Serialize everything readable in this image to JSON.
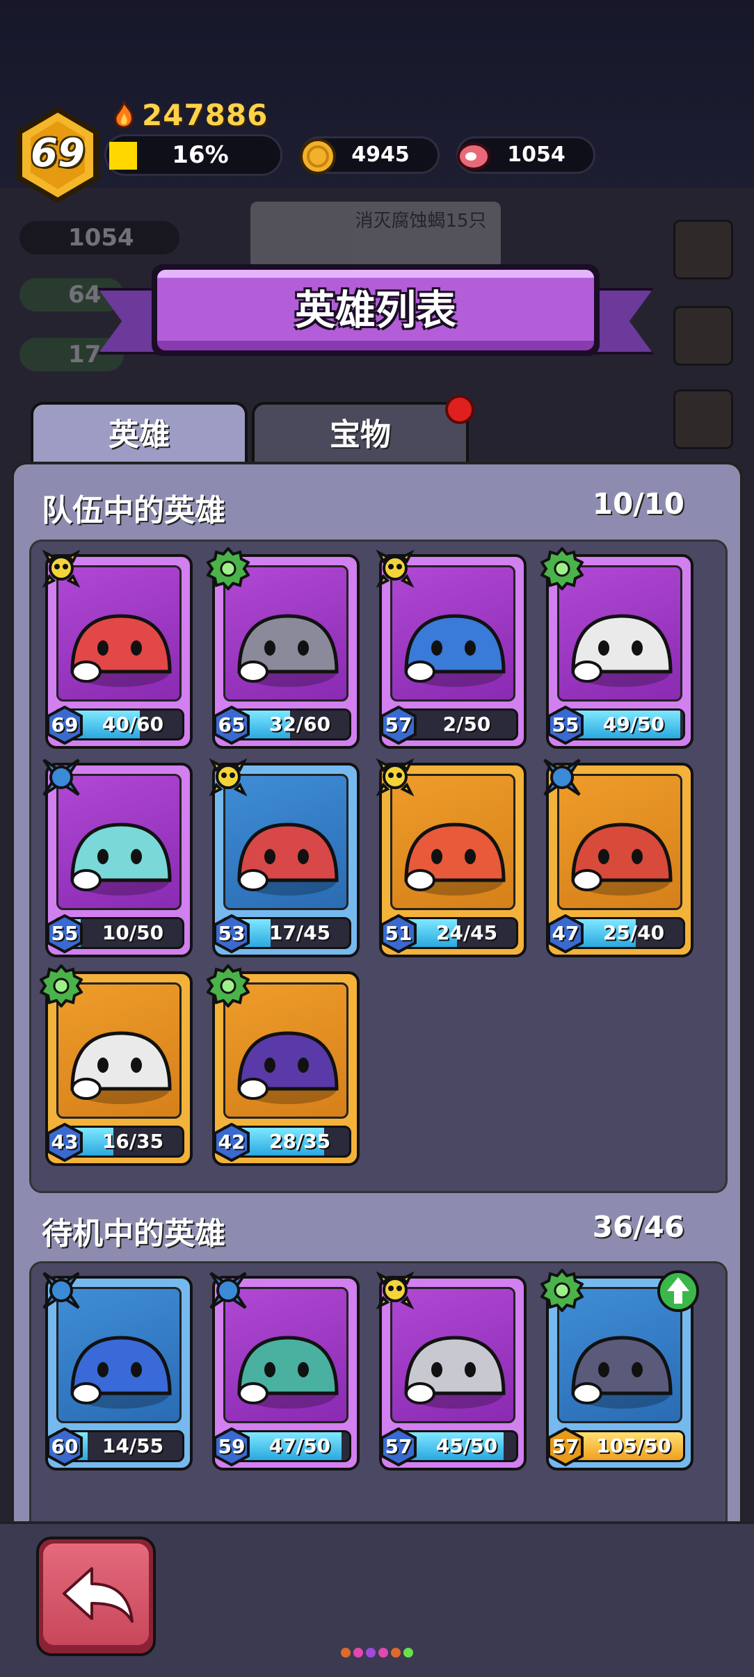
{
  "header": {
    "level": "69",
    "power": "247886",
    "xp_percent_text": "16%",
    "xp_fraction": 0.16,
    "gold": "4945",
    "meat": "1054"
  },
  "background": {
    "meat": "1054",
    "wood": "64",
    "ore": "17",
    "quest": "消灭腐蚀蝎15只"
  },
  "title": "英雄列表",
  "tabs": [
    {
      "label": "英雄",
      "active": true
    },
    {
      "label": "宝物",
      "active": false,
      "badge": true
    }
  ],
  "team": {
    "heading": "队伍中的英雄",
    "count": "10/10",
    "heroes": [
      {
        "level": "69",
        "progress": "40/60",
        "frame": "purple",
        "class": "yellow-skull",
        "fill": 0.667,
        "full": false
      },
      {
        "level": "65",
        "progress": "32/60",
        "frame": "purple",
        "class": "green-gear",
        "fill": 0.533,
        "full": false
      },
      {
        "level": "57",
        "progress": "2/50",
        "frame": "purple",
        "class": "yellow-skull",
        "fill": 0.04,
        "full": false
      },
      {
        "level": "55",
        "progress": "49/50",
        "frame": "purple",
        "class": "green-gear",
        "fill": 0.98,
        "full": false
      },
      {
        "level": "55",
        "progress": "10/50",
        "frame": "purple",
        "class": "blue-cross",
        "fill": 0.2,
        "full": false
      },
      {
        "level": "53",
        "progress": "17/45",
        "frame": "blue",
        "class": "yellow-skull",
        "fill": 0.378,
        "full": false
      },
      {
        "level": "51",
        "progress": "24/45",
        "frame": "gold",
        "class": "yellow-skull",
        "fill": 0.533,
        "full": false
      },
      {
        "level": "47",
        "progress": "25/40",
        "frame": "gold",
        "class": "blue-cross",
        "fill": 0.625,
        "full": false
      },
      {
        "level": "43",
        "progress": "16/35",
        "frame": "gold",
        "class": "green-gear",
        "fill": 0.457,
        "full": false
      },
      {
        "level": "42",
        "progress": "28/35",
        "frame": "gold",
        "class": "green-gear",
        "fill": 0.8,
        "full": false
      }
    ]
  },
  "standby": {
    "heading": "待机中的英雄",
    "count": "36/46",
    "heroes": [
      {
        "level": "60",
        "progress": "14/55",
        "frame": "blue",
        "class": "blue-cross",
        "fill": 0.255,
        "full": false
      },
      {
        "level": "59",
        "progress": "47/50",
        "frame": "purple",
        "class": "blue-cross",
        "fill": 0.94,
        "full": false
      },
      {
        "level": "57",
        "progress": "45/50",
        "frame": "purple",
        "class": "yellow-skull",
        "fill": 0.9,
        "full": false
      },
      {
        "level": "57",
        "progress": "105/50",
        "frame": "blue",
        "class": "green-gear",
        "fill": 1.0,
        "full": true,
        "upgrade": true
      }
    ]
  },
  "colors": {
    "panel": "#8d8cb0",
    "grid": "#4a4863",
    "banner": "#b35ed8",
    "accent_gold": "#ffd24a"
  }
}
